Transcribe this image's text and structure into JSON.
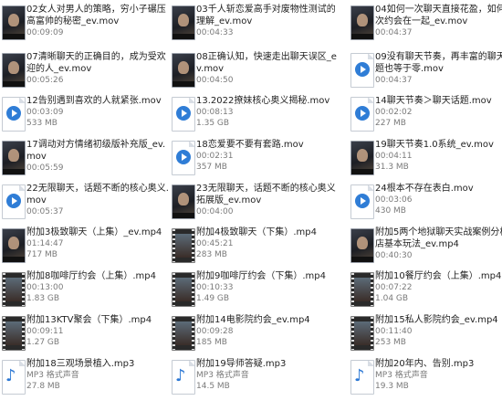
{
  "files": [
    {
      "name": "02女人对男人的策略，穷小子碾压高富帅的秘密_ev.mov",
      "sub": "00:09:09",
      "icon": "video-thumbnail"
    },
    {
      "name": "03千人斩恋爱高手对废物性测试的理解_ev.mov",
      "sub": "00:04:33",
      "icon": "video-thumbnail"
    },
    {
      "name": "04如何一次聊天直接花盈，如何一次约会在一起_ev.mov",
      "sub": "00:04:37",
      "icon": "video-thumbnail"
    },
    {
      "name": "07清晰聊天的正确目的，成为受欢迎的人_ev.mov",
      "sub": "00:05:26",
      "icon": "video-thumbnail"
    },
    {
      "name": "08正确认知，快速走出聊天误区_ev.mov",
      "sub": "00:04:50",
      "icon": "video-thumbnail"
    },
    {
      "name": "09没有聊天节奏，再丰富的聊天话题也等于零.mov",
      "sub": "00:04:37",
      "icon": "video-file-icon"
    },
    {
      "name": "12告别遇到喜欢的人就紧张.mov",
      "sub": "00:03:09",
      "size": "533 MB",
      "icon": "video-file-icon"
    },
    {
      "name": "13.2022撩妹核心奥义揭秘.mov",
      "sub": "00:08:13",
      "size": "1.35 GB",
      "icon": "video-file-icon"
    },
    {
      "name": "14聊天节奏＞聊天话题.mov",
      "sub": "00:02:02",
      "size": "227 MB",
      "icon": "video-file-icon"
    },
    {
      "name": "17调动对方情绪初级版补充版_ev.mov",
      "sub": "00:05:59",
      "icon": "video-thumbnail"
    },
    {
      "name": "18恋爱要不要有套路.mov",
      "sub": "00:02:31",
      "size": "357 MB",
      "icon": "video-file-icon"
    },
    {
      "name": "19聊天节奏1.0系统_ev.mov",
      "sub": "00:04:11",
      "size": "31.3 MB",
      "icon": "video-thumbnail"
    },
    {
      "name": "22无限聊天，话题不断的核心奥义.mov",
      "sub": "00:05:37",
      "icon": "video-file-icon"
    },
    {
      "name": "23无限聊天，话题不断的核心奥义拓展版_ev.mov",
      "sub": "00:04:00",
      "icon": "video-thumbnail"
    },
    {
      "name": "24根本不存在表白.mov",
      "sub": "00:03:06",
      "size": "430 MB",
      "icon": "video-file-icon"
    },
    {
      "name": "附加3极致聊天（上集）_ev.mp4",
      "sub": "01:14:47",
      "size": "717 MB",
      "icon": "video-thumbnail"
    },
    {
      "name": "附加4极致聊天（下集）.mp4",
      "sub": "00:45:21",
      "size": "283 MB",
      "icon": "film-icon"
    },
    {
      "name": "附加5两个地狱聊天实战案例分析夜店基本玩法_ev.mp4",
      "sub": "00:40:30",
      "icon": "video-thumbnail"
    },
    {
      "name": "附加8咖啡厅约会（上集）.mp4",
      "sub": "00:13:00",
      "size": "1.83 GB",
      "icon": "film-icon"
    },
    {
      "name": "附加9咖啡厅约会（下集）.mp4",
      "sub": "00:10:33",
      "size": "1.49 GB",
      "icon": "film-icon"
    },
    {
      "name": "附加10餐厅约会（上集）.mp4",
      "sub": "00:07:22",
      "size": "1.04 GB",
      "icon": "film-icon"
    },
    {
      "name": "附加13KTV聚会（下集）.mp4",
      "sub": "00:09:11",
      "size": "1.27 GB",
      "icon": "film-icon"
    },
    {
      "name": "附加14电影院约会_ev.mp4",
      "sub": "00:09:28",
      "size": "185 MB",
      "icon": "film-icon"
    },
    {
      "name": "附加15私人影院约会_ev.mp4",
      "sub": "00:11:40",
      "size": "253 MB",
      "icon": "film-icon"
    },
    {
      "name": "附加18三观场景植入.mp3",
      "sub": "MP3 格式声音",
      "size": "27.8 MB",
      "icon": "audio-file-icon"
    },
    {
      "name": "附加19导师答疑.mp3",
      "sub": "MP3 格式声音",
      "size": "14.5 MB",
      "icon": "audio-file-icon"
    },
    {
      "name": "附加20年内、告别.mp3",
      "sub": "MP3 格式声音",
      "size": "19.3 MB",
      "icon": "audio-file-icon"
    }
  ]
}
